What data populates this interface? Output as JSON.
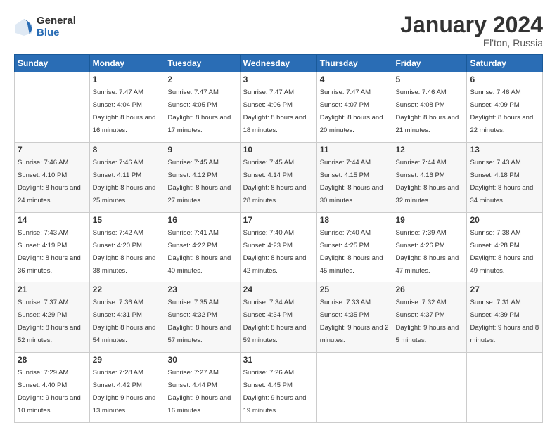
{
  "logo": {
    "general": "General",
    "blue": "Blue"
  },
  "header": {
    "title": "January 2024",
    "location": "El'ton, Russia"
  },
  "days_of_week": [
    "Sunday",
    "Monday",
    "Tuesday",
    "Wednesday",
    "Thursday",
    "Friday",
    "Saturday"
  ],
  "weeks": [
    [
      {
        "day": "",
        "sunrise": "",
        "sunset": "",
        "daylight": ""
      },
      {
        "day": "1",
        "sunrise": "7:47 AM",
        "sunset": "4:04 PM",
        "daylight": "8 hours and 16 minutes."
      },
      {
        "day": "2",
        "sunrise": "7:47 AM",
        "sunset": "4:05 PM",
        "daylight": "8 hours and 17 minutes."
      },
      {
        "day": "3",
        "sunrise": "7:47 AM",
        "sunset": "4:06 PM",
        "daylight": "8 hours and 18 minutes."
      },
      {
        "day": "4",
        "sunrise": "7:47 AM",
        "sunset": "4:07 PM",
        "daylight": "8 hours and 20 minutes."
      },
      {
        "day": "5",
        "sunrise": "7:46 AM",
        "sunset": "4:08 PM",
        "daylight": "8 hours and 21 minutes."
      },
      {
        "day": "6",
        "sunrise": "7:46 AM",
        "sunset": "4:09 PM",
        "daylight": "8 hours and 22 minutes."
      }
    ],
    [
      {
        "day": "7",
        "sunrise": "7:46 AM",
        "sunset": "4:10 PM",
        "daylight": "8 hours and 24 minutes."
      },
      {
        "day": "8",
        "sunrise": "7:46 AM",
        "sunset": "4:11 PM",
        "daylight": "8 hours and 25 minutes."
      },
      {
        "day": "9",
        "sunrise": "7:45 AM",
        "sunset": "4:12 PM",
        "daylight": "8 hours and 27 minutes."
      },
      {
        "day": "10",
        "sunrise": "7:45 AM",
        "sunset": "4:14 PM",
        "daylight": "8 hours and 28 minutes."
      },
      {
        "day": "11",
        "sunrise": "7:44 AM",
        "sunset": "4:15 PM",
        "daylight": "8 hours and 30 minutes."
      },
      {
        "day": "12",
        "sunrise": "7:44 AM",
        "sunset": "4:16 PM",
        "daylight": "8 hours and 32 minutes."
      },
      {
        "day": "13",
        "sunrise": "7:43 AM",
        "sunset": "4:18 PM",
        "daylight": "8 hours and 34 minutes."
      }
    ],
    [
      {
        "day": "14",
        "sunrise": "7:43 AM",
        "sunset": "4:19 PM",
        "daylight": "8 hours and 36 minutes."
      },
      {
        "day": "15",
        "sunrise": "7:42 AM",
        "sunset": "4:20 PM",
        "daylight": "8 hours and 38 minutes."
      },
      {
        "day": "16",
        "sunrise": "7:41 AM",
        "sunset": "4:22 PM",
        "daylight": "8 hours and 40 minutes."
      },
      {
        "day": "17",
        "sunrise": "7:40 AM",
        "sunset": "4:23 PM",
        "daylight": "8 hours and 42 minutes."
      },
      {
        "day": "18",
        "sunrise": "7:40 AM",
        "sunset": "4:25 PM",
        "daylight": "8 hours and 45 minutes."
      },
      {
        "day": "19",
        "sunrise": "7:39 AM",
        "sunset": "4:26 PM",
        "daylight": "8 hours and 47 minutes."
      },
      {
        "day": "20",
        "sunrise": "7:38 AM",
        "sunset": "4:28 PM",
        "daylight": "8 hours and 49 minutes."
      }
    ],
    [
      {
        "day": "21",
        "sunrise": "7:37 AM",
        "sunset": "4:29 PM",
        "daylight": "8 hours and 52 minutes."
      },
      {
        "day": "22",
        "sunrise": "7:36 AM",
        "sunset": "4:31 PM",
        "daylight": "8 hours and 54 minutes."
      },
      {
        "day": "23",
        "sunrise": "7:35 AM",
        "sunset": "4:32 PM",
        "daylight": "8 hours and 57 minutes."
      },
      {
        "day": "24",
        "sunrise": "7:34 AM",
        "sunset": "4:34 PM",
        "daylight": "8 hours and 59 minutes."
      },
      {
        "day": "25",
        "sunrise": "7:33 AM",
        "sunset": "4:35 PM",
        "daylight": "9 hours and 2 minutes."
      },
      {
        "day": "26",
        "sunrise": "7:32 AM",
        "sunset": "4:37 PM",
        "daylight": "9 hours and 5 minutes."
      },
      {
        "day": "27",
        "sunrise": "7:31 AM",
        "sunset": "4:39 PM",
        "daylight": "9 hours and 8 minutes."
      }
    ],
    [
      {
        "day": "28",
        "sunrise": "7:29 AM",
        "sunset": "4:40 PM",
        "daylight": "9 hours and 10 minutes."
      },
      {
        "day": "29",
        "sunrise": "7:28 AM",
        "sunset": "4:42 PM",
        "daylight": "9 hours and 13 minutes."
      },
      {
        "day": "30",
        "sunrise": "7:27 AM",
        "sunset": "4:44 PM",
        "daylight": "9 hours and 16 minutes."
      },
      {
        "day": "31",
        "sunrise": "7:26 AM",
        "sunset": "4:45 PM",
        "daylight": "9 hours and 19 minutes."
      },
      {
        "day": "",
        "sunrise": "",
        "sunset": "",
        "daylight": ""
      },
      {
        "day": "",
        "sunrise": "",
        "sunset": "",
        "daylight": ""
      },
      {
        "day": "",
        "sunrise": "",
        "sunset": "",
        "daylight": ""
      }
    ]
  ]
}
